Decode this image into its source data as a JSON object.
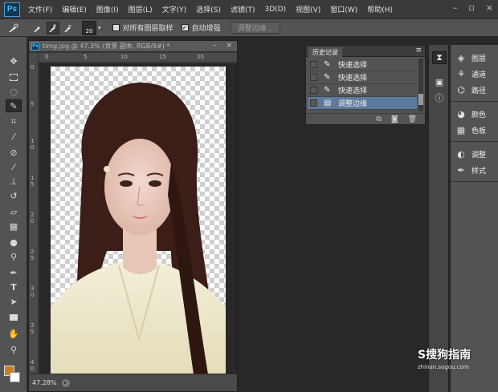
{
  "app": {
    "logo": "Ps"
  },
  "menu": [
    "文件(F)",
    "编辑(E)",
    "图像(I)",
    "图层(L)",
    "文字(Y)",
    "选择(S)",
    "滤镜(T)",
    "3D(D)",
    "视图(V)",
    "窗口(W)",
    "帮助(H)"
  ],
  "window_controls": {
    "minimize": "–",
    "restore": "▫",
    "close": "×"
  },
  "options": {
    "brush_size": "20",
    "sample_all_layers": "对所有图层取样",
    "sample_all_layers_checked": false,
    "auto_enhance": "自动增强",
    "auto_enhance_checked": true,
    "refine_edge": "调整边缘..."
  },
  "document": {
    "icon": "Ps",
    "title": "timg.jpg @ 47.3% (背景 副本, RGB/8#) *",
    "zoom": "47.28%",
    "ruler_top": [
      "0",
      "5",
      "10",
      "15",
      "20"
    ],
    "ruler_left": [
      "0",
      "5",
      "1 0",
      "1 5",
      "2 0",
      "2 5",
      "3 0",
      "3 5",
      "4 0"
    ]
  },
  "history": {
    "tab": "历史记录",
    "items": [
      {
        "label": "快速选择",
        "icon": "brush-icon",
        "selected": false
      },
      {
        "label": "快速选择",
        "icon": "brush-icon",
        "selected": false
      },
      {
        "label": "快速选择",
        "icon": "brush-icon",
        "selected": false
      },
      {
        "label": "调整边缘",
        "icon": "document-icon",
        "selected": true
      }
    ]
  },
  "dock": {
    "group1": [
      {
        "label": "图层",
        "icon": "layers-icon"
      },
      {
        "label": "通道",
        "icon": "channels-icon"
      },
      {
        "label": "路径",
        "icon": "paths-icon"
      }
    ],
    "group2": [
      {
        "label": "颜色",
        "icon": "color-icon"
      },
      {
        "label": "色板",
        "icon": "swatches-icon"
      }
    ],
    "group3": [
      {
        "label": "调整",
        "icon": "adjustments-icon"
      },
      {
        "label": "样式",
        "icon": "styles-icon"
      }
    ]
  },
  "colors": {
    "foreground": "#c8801e",
    "background": "#ffffff",
    "selection": "#5d7a9c"
  },
  "watermark": {
    "brand": "S搜狗指南",
    "url": "zhinan.sogou.com"
  }
}
